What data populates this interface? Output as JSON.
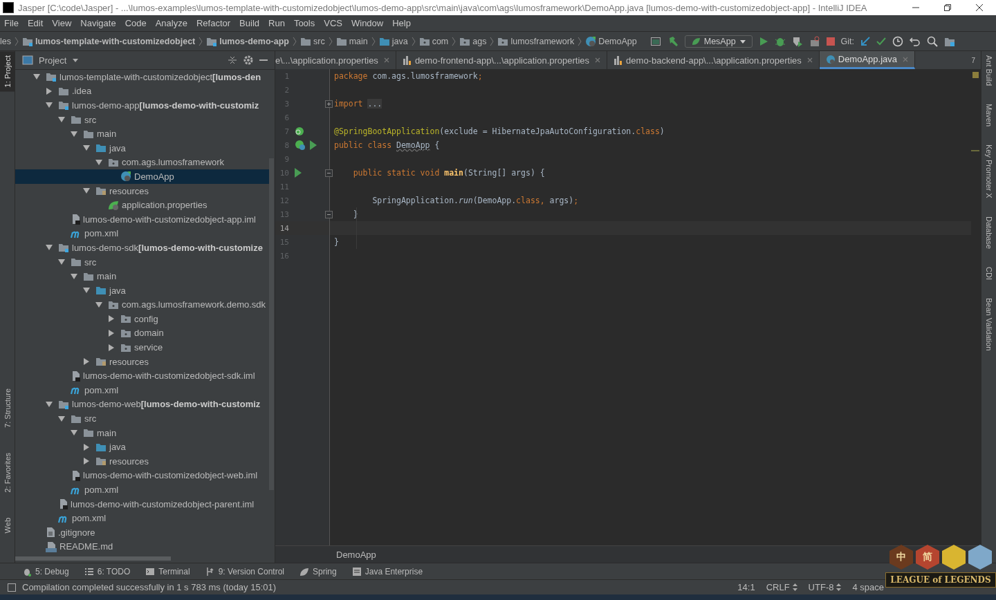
{
  "window": {
    "title": "Jasper [C:\\code\\Jasper] - ...\\lumos-examples\\lumos-template-with-customizedobject\\lumos-demo-app\\src\\main\\java\\com\\ags\\lumosframework\\DemoApp.java [lumos-demo-with-customizedobject-app] - IntelliJ IDEA"
  },
  "menu": [
    "File",
    "Edit",
    "View",
    "Navigate",
    "Code",
    "Analyze",
    "Refactor",
    "Build",
    "Run",
    "Tools",
    "VCS",
    "Window",
    "Help"
  ],
  "breadcrumbs": [
    {
      "label": "les",
      "kind": "plain"
    },
    {
      "label": "lumos-template-with-customizedobject",
      "kind": "module"
    },
    {
      "label": "lumos-demo-app",
      "kind": "module"
    },
    {
      "label": "src",
      "kind": "folder"
    },
    {
      "label": "main",
      "kind": "folder"
    },
    {
      "label": "java",
      "kind": "source"
    },
    {
      "label": "com",
      "kind": "package"
    },
    {
      "label": "ags",
      "kind": "package"
    },
    {
      "label": "lumosframework",
      "kind": "package"
    },
    {
      "label": "DemoApp",
      "kind": "class"
    }
  ],
  "run_config": "MesApp",
  "git_label": "Git:",
  "left_tools": [
    {
      "label": "1: Project",
      "selected": true
    },
    {
      "label": "7: Structure",
      "selected": false
    },
    {
      "label": "2: Favorites",
      "selected": false
    },
    {
      "label": "Web",
      "selected": false
    }
  ],
  "right_tools": [
    "Ant Build",
    "Maven",
    "Key Promoter X",
    "Database",
    "CDI",
    "Bean Validation"
  ],
  "project_panel": {
    "title": "Project",
    "tree": [
      {
        "label": "lumos-template-with-customizedobject",
        "suffix": "[lumos-den",
        "kind": "module",
        "expanded": true,
        "selected": false,
        "children": [
          {
            "label": ".idea",
            "kind": "folder",
            "expanded": false,
            "selected": false
          },
          {
            "label": "lumos-demo-app",
            "suffix": "[lumos-demo-with-customiz",
            "kind": "module",
            "expanded": true,
            "selected": false,
            "children": [
              {
                "label": "src",
                "kind": "folder",
                "expanded": true,
                "selected": false,
                "children": [
                  {
                    "label": "main",
                    "kind": "folder",
                    "expanded": true,
                    "selected": false,
                    "children": [
                      {
                        "label": "java",
                        "kind": "source",
                        "expanded": true,
                        "selected": false,
                        "children": [
                          {
                            "label": "com.ags.lumosframework",
                            "kind": "package",
                            "expanded": true,
                            "selected": false,
                            "children": [
                              {
                                "label": "DemoApp",
                                "kind": "class",
                                "selected": true
                              }
                            ]
                          }
                        ]
                      },
                      {
                        "label": "resources",
                        "kind": "resources",
                        "expanded": true,
                        "selected": false,
                        "children": [
                          {
                            "label": "application.properties",
                            "kind": "properties",
                            "selected": false
                          }
                        ]
                      }
                    ]
                  }
                ]
              },
              {
                "label": "lumos-demo-with-customizedobject-app.iml",
                "kind": "iml",
                "selected": false
              },
              {
                "label": "pom.xml",
                "kind": "maven",
                "selected": false
              }
            ]
          },
          {
            "label": "lumos-demo-sdk",
            "suffix": "[lumos-demo-with-customize",
            "kind": "module",
            "expanded": true,
            "selected": false,
            "children": [
              {
                "label": "src",
                "kind": "folder",
                "expanded": true,
                "selected": false,
                "children": [
                  {
                    "label": "main",
                    "kind": "folder",
                    "expanded": true,
                    "selected": false,
                    "children": [
                      {
                        "label": "java",
                        "kind": "source",
                        "expanded": true,
                        "selected": false,
                        "children": [
                          {
                            "label": "com.ags.lumosframework.demo.sdk",
                            "kind": "package",
                            "expanded": true,
                            "selected": false,
                            "children": [
                              {
                                "label": "config",
                                "kind": "package",
                                "expanded": false,
                                "selected": false
                              },
                              {
                                "label": "domain",
                                "kind": "package",
                                "expanded": false,
                                "selected": false
                              },
                              {
                                "label": "service",
                                "kind": "package",
                                "expanded": false,
                                "selected": false
                              }
                            ]
                          }
                        ]
                      },
                      {
                        "label": "resources",
                        "kind": "resources",
                        "expanded": false,
                        "selected": false
                      }
                    ]
                  }
                ]
              },
              {
                "label": "lumos-demo-with-customizedobject-sdk.iml",
                "kind": "iml",
                "selected": false
              },
              {
                "label": "pom.xml",
                "kind": "maven",
                "selected": false
              }
            ]
          },
          {
            "label": "lumos-demo-web",
            "suffix": "[lumos-demo-with-customiz",
            "kind": "module",
            "expanded": true,
            "selected": false,
            "children": [
              {
                "label": "src",
                "kind": "folder",
                "expanded": true,
                "selected": false,
                "children": [
                  {
                    "label": "main",
                    "kind": "folder",
                    "expanded": true,
                    "selected": false,
                    "children": [
                      {
                        "label": "java",
                        "kind": "source",
                        "expanded": false,
                        "selected": false
                      },
                      {
                        "label": "resources",
                        "kind": "resources",
                        "expanded": false,
                        "selected": false
                      }
                    ]
                  }
                ]
              },
              {
                "label": "lumos-demo-with-customizedobject-web.iml",
                "kind": "iml",
                "selected": false
              },
              {
                "label": "pom.xml",
                "kind": "maven",
                "selected": false
              }
            ]
          },
          {
            "label": "lumos-demo-with-customizedobject-parent.iml",
            "kind": "iml",
            "selected": false
          },
          {
            "label": "pom.xml",
            "kind": "maven",
            "selected": false
          }
        ]
      },
      {
        "label": ".gitignore",
        "kind": "text",
        "selected": false
      },
      {
        "label": "README.md",
        "kind": "markdown",
        "selected": false
      }
    ]
  },
  "tabs": [
    {
      "label": "e\\...\\application.properties",
      "kind": "properties",
      "selected": false
    },
    {
      "label": "demo-frontend-app\\...\\application.properties",
      "kind": "properties",
      "selected": false
    },
    {
      "label": "demo-backend-app\\...\\application.properties",
      "kind": "properties",
      "selected": false
    },
    {
      "label": "DemoApp.java",
      "kind": "class",
      "selected": true
    }
  ],
  "tab_count": "7",
  "code": [
    {
      "number": "1",
      "current": false,
      "tokens": [
        {
          "text": "package ",
          "kind": "keyword"
        },
        {
          "text": "com.ags.lumosframework",
          "kind": "plain"
        },
        {
          "text": ";",
          "kind": "keyword"
        }
      ]
    },
    {
      "number": "2",
      "current": false
    },
    {
      "number": "3",
      "current": false,
      "folded": true,
      "tokens": [
        {
          "text": "import ",
          "kind": "keyword"
        },
        {
          "text": "...",
          "kind": "folded"
        }
      ]
    },
    {
      "number": "6",
      "current": false
    },
    {
      "number": "7",
      "current": false,
      "spring_marker": true,
      "tokens": [
        {
          "text": "@SpringBootApplication",
          "kind": "annotation"
        },
        {
          "text": "(exclude = HibernateJpaAutoConfiguration.",
          "kind": "plain"
        },
        {
          "text": "class",
          "kind": "keyword"
        },
        {
          "text": ")",
          "kind": "plain"
        }
      ]
    },
    {
      "number": "8",
      "current": false,
      "bean_marker": true,
      "run_marker": true,
      "tokens": [
        {
          "text": "public class ",
          "kind": "keyword"
        },
        {
          "text": "DemoApp",
          "kind": "warning"
        },
        {
          "text": " {",
          "kind": "plain"
        }
      ]
    },
    {
      "number": "9",
      "current": false
    },
    {
      "number": "10",
      "current": false,
      "folded": false,
      "run_marker": true,
      "tokens": [
        {
          "text": "    public static void ",
          "kind": "keyword"
        },
        {
          "text": "main",
          "kind": "method"
        },
        {
          "text": "(String[] args) {",
          "kind": "plain"
        }
      ]
    },
    {
      "number": "11",
      "current": false
    },
    {
      "number": "12",
      "current": false,
      "tokens": [
        {
          "text": "        SpringApplication.",
          "kind": "plain"
        },
        {
          "text": "run",
          "kind": "static"
        },
        {
          "text": "(DemoApp.",
          "kind": "plain"
        },
        {
          "text": "class",
          "kind": "keyword"
        },
        {
          "text": ", ",
          "kind": "keyword"
        },
        {
          "text": "args)",
          "kind": "plain"
        },
        {
          "text": ";",
          "kind": "keyword"
        }
      ]
    },
    {
      "number": "13",
      "current": false,
      "folded": false,
      "tokens": [
        {
          "text": "    }",
          "kind": "plain"
        }
      ]
    },
    {
      "number": "14",
      "current": true
    },
    {
      "number": "15",
      "current": false,
      "tokens": [
        {
          "text": "}",
          "kind": "plain"
        }
      ]
    },
    {
      "number": "16",
      "current": false
    }
  ],
  "editor_breadcrumb": "DemoApp",
  "tool_windows": [
    {
      "label": "5: Debug",
      "kind": "debug"
    },
    {
      "label": "6: TODO",
      "kind": "todo"
    },
    {
      "label": "Terminal",
      "kind": "terminal"
    },
    {
      "label": "9: Version Control",
      "kind": "vcs"
    },
    {
      "label": "Spring",
      "kind": "spring"
    },
    {
      "label": "Java Enterprise",
      "kind": "enterprise"
    }
  ],
  "status": {
    "message": "Compilation completed successfully in 1 s 783 ms (today 15:01)",
    "position": "14:1",
    "line_sep": "CRLF",
    "encoding": "UTF-8",
    "indent": "4 space"
  },
  "ime_toolbar": {
    "buttons": [
      {
        "label": "中",
        "color": "#6b3a1e"
      },
      {
        "label": "简",
        "color": "#b5452f"
      },
      {
        "color": "#d9b530"
      },
      {
        "color": "#7fa8c9"
      }
    ],
    "logo": "LEAGUE of LEGENDS"
  }
}
